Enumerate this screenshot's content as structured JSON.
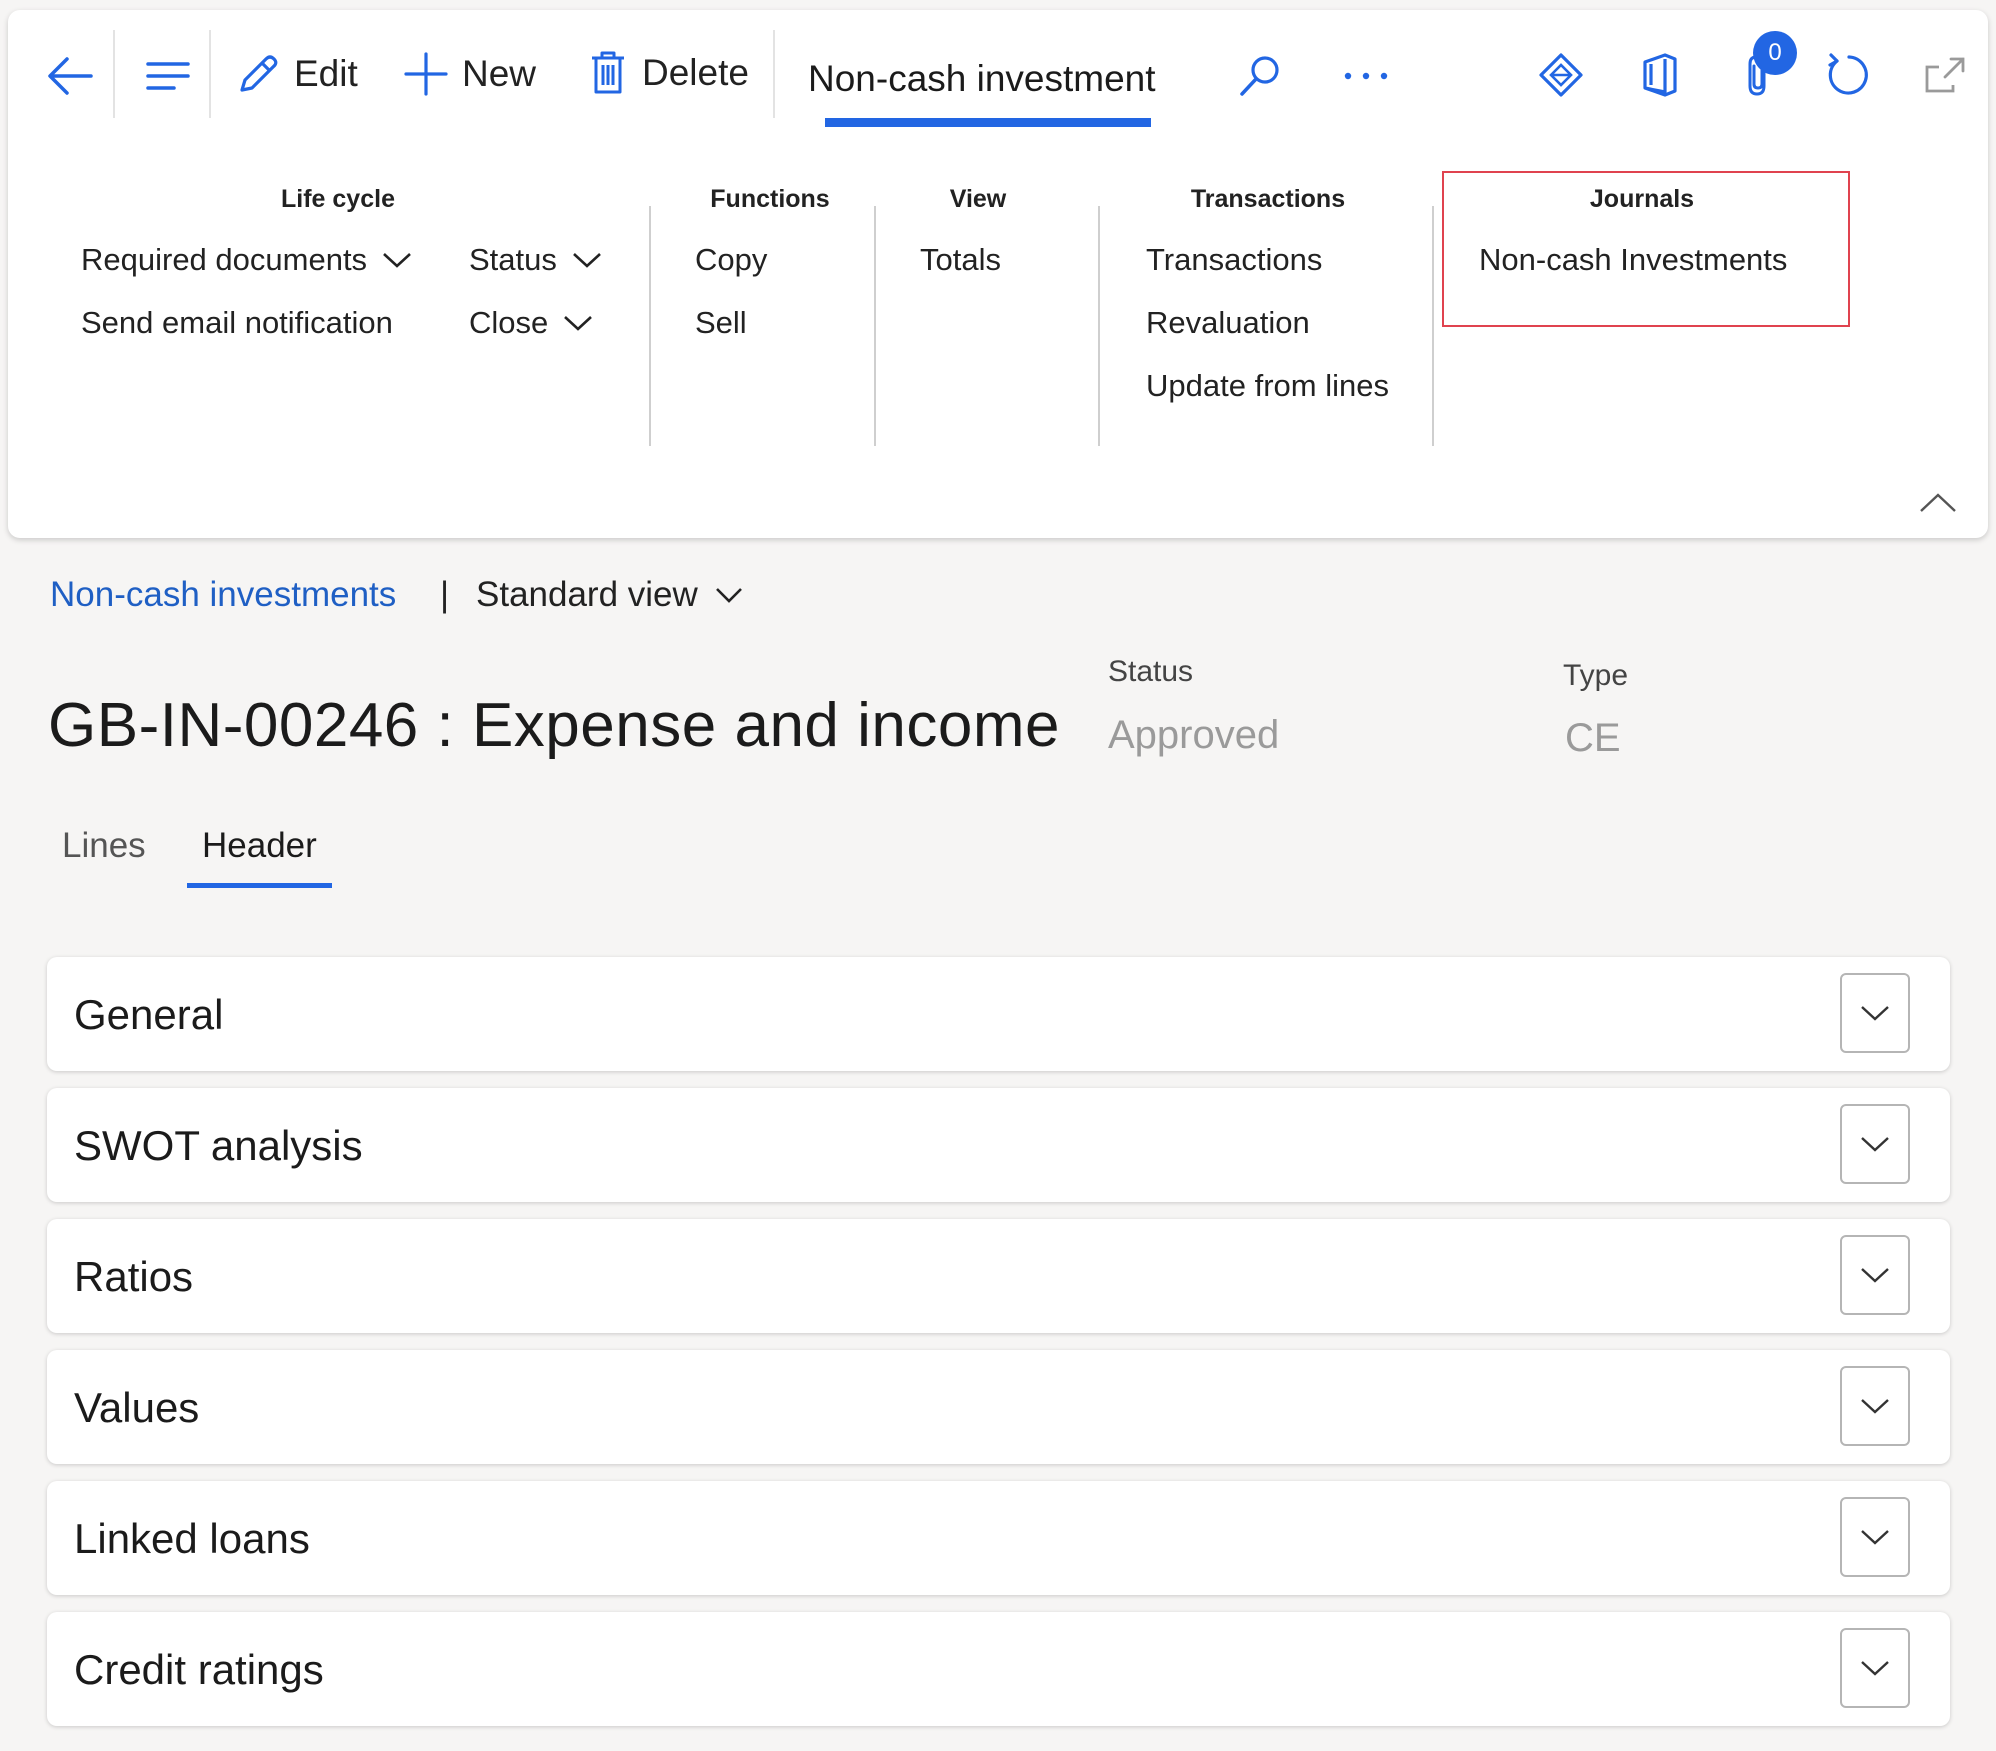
{
  "toolbar": {
    "edit_label": "Edit",
    "new_label": "New",
    "delete_label": "Delete",
    "active_tab": "Non-cash investment",
    "attachments_badge": "0",
    "icons": [
      "back-arrow-icon",
      "hamburger-menu-icon",
      "pencil-icon",
      "plus-icon",
      "trash-icon",
      "search-icon",
      "more-icon",
      "power-apps-icon",
      "office-icon",
      "paperclip-icon",
      "refresh-icon",
      "open-new-window-icon"
    ]
  },
  "ribbon": {
    "life_cycle": {
      "title": "Life cycle",
      "required_documents": "Required documents",
      "send_email": "Send email notification",
      "status": "Status",
      "close": "Close"
    },
    "functions": {
      "title": "Functions",
      "items": [
        "Copy",
        "Sell"
      ]
    },
    "view": {
      "title": "View",
      "items": [
        "Totals"
      ]
    },
    "transactions": {
      "title": "Transactions",
      "items": [
        "Transactions",
        "Revaluation",
        "Update from lines"
      ]
    },
    "journals": {
      "title": "Journals",
      "items": [
        "Non-cash Investments"
      ]
    },
    "highlight_color": "#e0434f"
  },
  "breadcrumb": {
    "link": "Non-cash investments",
    "separator": "|",
    "view": "Standard view"
  },
  "record": {
    "title": "GB-IN-00246 : Expense and income",
    "status_label": "Status",
    "status_value": "Approved",
    "type_label": "Type",
    "type_value": "CE"
  },
  "tabs": [
    {
      "label": "Lines",
      "active": false
    },
    {
      "label": "Header",
      "active": true
    }
  ],
  "sections": [
    "General",
    "SWOT analysis",
    "Ratios",
    "Values",
    "Linked loans",
    "Credit ratings"
  ],
  "colors": {
    "accent": "#2266e3",
    "link": "#1f5fc4"
  }
}
